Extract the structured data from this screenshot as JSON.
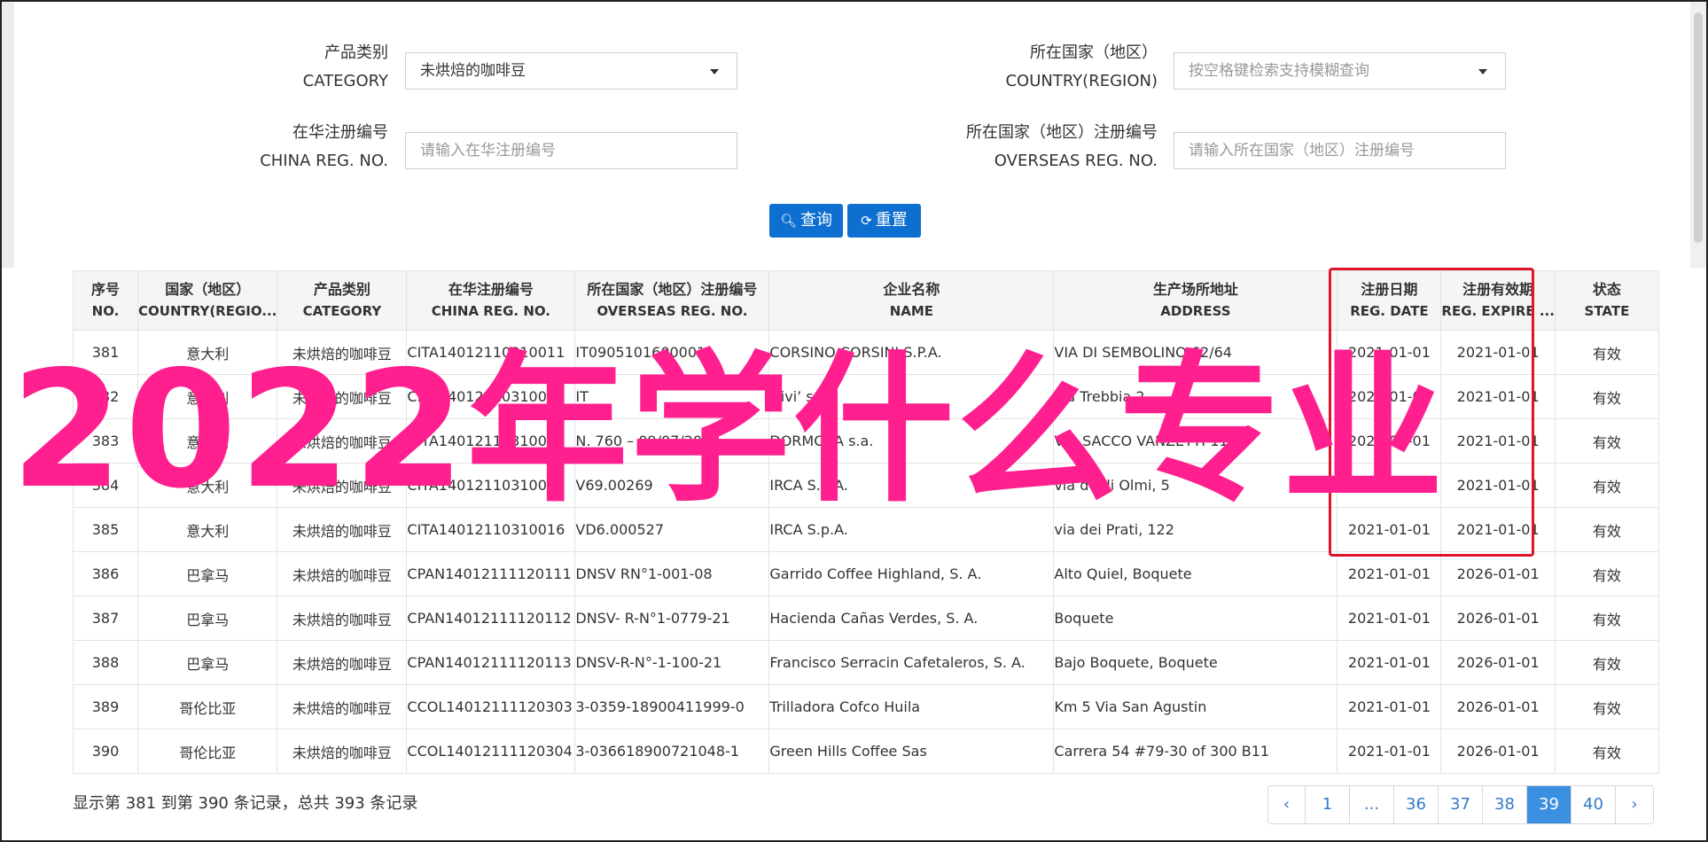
{
  "filters": {
    "category_label_zh": "产品类别",
    "category_label_en": "CATEGORY",
    "category_value": "未烘焙的咖啡豆",
    "country_label_zh": "所在国家（地区）",
    "country_label_en": "COUNTRY(REGION)",
    "country_placeholder": "按空格键检索支持模糊查询",
    "china_reg_label_zh": "在华注册编号",
    "china_reg_label_en": "CHINA REG. NO.",
    "china_reg_placeholder": "请输入在华注册编号",
    "overseas_reg_label_zh": "所在国家（地区）注册编号",
    "overseas_reg_label_en": "OVERSEAS REG. NO.",
    "overseas_reg_placeholder": "请输入所在国家（地区）注册编号"
  },
  "buttons": {
    "query": "查询",
    "reset": "重置"
  },
  "table": {
    "headers": [
      {
        "zh": "序号",
        "en": "NO."
      },
      {
        "zh": "国家（地区）",
        "en": "COUNTRY(REGIO..."
      },
      {
        "zh": "产品类别",
        "en": "CATEGORY"
      },
      {
        "zh": "在华注册编号",
        "en": "CHINA REG. NO."
      },
      {
        "zh": "所在国家（地区）注册编号",
        "en": "OVERSEAS REG. NO."
      },
      {
        "zh": "企业名称",
        "en": "NAME"
      },
      {
        "zh": "生产场所地址",
        "en": "ADDRESS"
      },
      {
        "zh": "注册日期",
        "en": "REG. DATE"
      },
      {
        "zh": "注册有效期",
        "en": "REG. EXPIRE ..."
      },
      {
        "zh": "状态",
        "en": "STATE"
      }
    ],
    "rows": [
      [
        "381",
        "意大利",
        "未烘焙的咖啡豆",
        "CITA14012110310011",
        "IT0905101600001",
        "CORSINO CORSINI S.P.A.",
        "VIA DI SEMBOLINO 62/64",
        "2021-01-01",
        "2021-01-01",
        "有效"
      ],
      [
        "382",
        "意大利",
        "未烘焙的咖啡豆",
        "CITA14012110310012",
        "IT",
        "Givi’ srl",
        "via Trebbia 2",
        "2021-01-01",
        "2021-01-01",
        "有效"
      ],
      [
        "383",
        "意大利",
        "未烘焙的咖啡豆",
        "CITA14012110310013",
        "N. 760 – 09/07/2003",
        "DORMOKA s.a.",
        "VIA SACCO VANZETTI 11",
        "2021-01-01",
        "2021-01-01",
        "有效"
      ],
      [
        "384",
        "意大利",
        "未烘焙的咖啡豆",
        "CITA14012110310014",
        "V69.00269",
        "IRCA S.p.A.",
        "via degli Olmi, 5",
        "2021-01-01",
        "2021-01-01",
        "有效"
      ],
      [
        "385",
        "意大利",
        "未烘焙的咖啡豆",
        "CITA14012110310016",
        "VD6.000527",
        "IRCA S.p.A.",
        "via dei Prati, 122",
        "2021-01-01",
        "2021-01-01",
        "有效"
      ],
      [
        "386",
        "巴拿马",
        "未烘焙的咖啡豆",
        "CPAN14012111120111",
        "DNSV RN°1-001-08",
        "Garrido Coffee Highland, S. A.",
        "Alto Quiel, Boquete",
        "2021-01-01",
        "2026-01-01",
        "有效"
      ],
      [
        "387",
        "巴拿马",
        "未烘焙的咖啡豆",
        "CPAN14012111120112",
        "DNSV- R-N°1-0779-21",
        "Hacienda Cañas Verdes, S. A.",
        "Boquete",
        "2021-01-01",
        "2026-01-01",
        "有效"
      ],
      [
        "388",
        "巴拿马",
        "未烘焙的咖啡豆",
        "CPAN14012111120113",
        "DNSV-R-N°-1-100-21",
        "Francisco Serracin Cafetaleros, S. A.",
        "Bajo Boquete, Boquete",
        "2021-01-01",
        "2026-01-01",
        "有效"
      ],
      [
        "389",
        "哥伦比亚",
        "未烘焙的咖啡豆",
        "CCOL14012111120303",
        "3-0359-18900411999-0",
        "Trilladora Cofco Huila",
        "Km 5 Via San Agustin",
        "2021-01-01",
        "2026-01-01",
        "有效"
      ],
      [
        "390",
        "哥伦比亚",
        "未烘焙的咖啡豆",
        "CCOL14012111120304",
        "3-036618900721048-1",
        "Green Hills Coffee Sas",
        "Carrera 54 #79-30 of 300 B11",
        "2021-01-01",
        "2026-01-01",
        "有效"
      ]
    ]
  },
  "footer": {
    "summary": "显示第 381 到第 390 条记录，总共 393 条记录"
  },
  "pagination": {
    "prev": "‹",
    "next": "›",
    "pages": [
      "1",
      "...",
      "36",
      "37",
      "38",
      "39",
      "40"
    ],
    "active": "39"
  },
  "overlay_text": "2022年学什么专业",
  "colors": {
    "primary": "#0d6fcf",
    "overlay": "#ff1f8f",
    "highlight_box": "#e0142b",
    "pager_active": "#3b8fe0"
  }
}
